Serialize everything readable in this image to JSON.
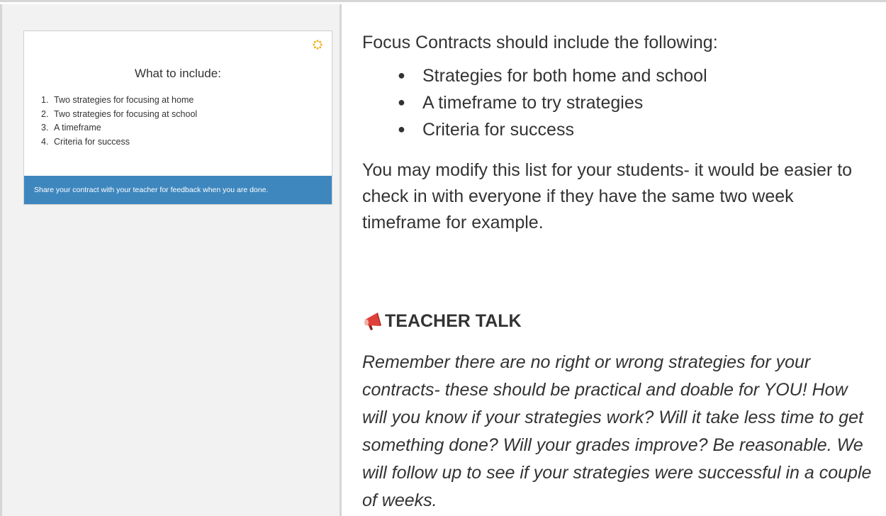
{
  "slide": {
    "title": "What to include:",
    "items": [
      {
        "num": "1.",
        "text": "Two strategies for focusing at home"
      },
      {
        "num": "2.",
        "text": "Two strategies for focusing at school"
      },
      {
        "num": "3.",
        "text": "A timeframe"
      },
      {
        "num": "4.",
        "text": "Criteria for success"
      }
    ],
    "footer": "Share your contract with your teacher for feedback when you are done.",
    "accent_color": "#3e87be",
    "loader_color": "#f0b323"
  },
  "content": {
    "intro": "Focus Contracts should include the following:",
    "bullets": [
      "Strategies for both home and school",
      "A timeframe to try strategies",
      "Criteria for success"
    ],
    "modify_text": "You may modify this list for your students- it would be easier to check in with everyone if they have the same two week timeframe for example.",
    "teacher_talk": {
      "icon": "megaphone-icon",
      "heading": "TEACHER TALK",
      "body": "Remember there are no right or wrong strategies for your contracts- these should be practical and doable for YOU! How will you know if your strategies work? Will it take less time to get something done? Will your grades improve? Be reasonable. We will follow up to see if your strategies were successful in a couple of weeks."
    }
  }
}
